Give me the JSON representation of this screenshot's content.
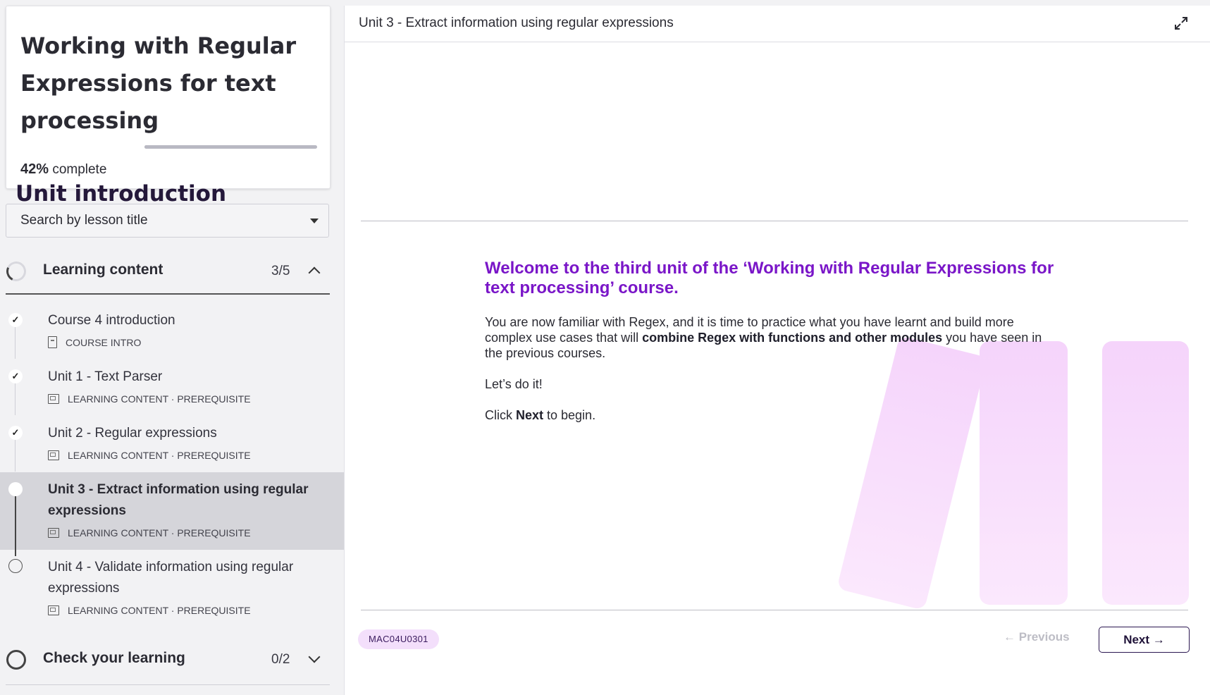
{
  "course": {
    "title": "Working with Regular Expressions for text processing",
    "progress_percent_label": "42%",
    "progress_suffix": "complete",
    "progress_value": 0.42
  },
  "search": {
    "placeholder": "Search by lesson title"
  },
  "sections": [
    {
      "label": "Learning content",
      "count": "3/5",
      "lessons": [
        {
          "title": "Course 4 introduction",
          "meta": "COURSE INTRO",
          "status": "done"
        },
        {
          "title": "Unit 1 - Text Parser",
          "meta": "LEARNING CONTENT · PREREQUISITE",
          "status": "done"
        },
        {
          "title": "Unit 2 - Regular expressions",
          "meta": "LEARNING CONTENT · PREREQUISITE",
          "status": "done"
        },
        {
          "title": "Unit 3 - Extract information using regular expressions",
          "meta": "LEARNING CONTENT · PREREQUISITE",
          "status": "current"
        },
        {
          "title": "Unit 4 - Validate information using regular expressions",
          "meta": "LEARNING CONTENT · PREREQUISITE",
          "status": "todo"
        }
      ]
    },
    {
      "label": "Check your learning",
      "count": "0/2"
    }
  ],
  "icons": {
    "check": "✓",
    "expand": "expand-icon",
    "prev_arrow": "←",
    "next_arrow": "→"
  },
  "main": {
    "header_title": "Unit 3 - Extract information using regular expressions",
    "heading": "Unit introduction",
    "welcome": "Welcome to the third unit of the ‘Working with Regular Expressions for text processing’ course.",
    "para1_a": "You are now familiar with Regex, and it is time to practice what you have learnt and build more complex use cases that will ",
    "para1_bold": "combine Regex with functions and other modules",
    "para1_b": " you have seen in the previous courses.",
    "para2": "Let’s do it!",
    "para3_a": "Click ",
    "para3_bold": "Next",
    "para3_b": " to begin.",
    "code": "MAC04U0301",
    "prev_label": "Previous",
    "next_label": "Next"
  },
  "colors": {
    "accent_purple": "#7a16c8",
    "heading_dark": "#24183a",
    "badge_bg": "#f3dffb",
    "active_row": "#d5d5da"
  }
}
